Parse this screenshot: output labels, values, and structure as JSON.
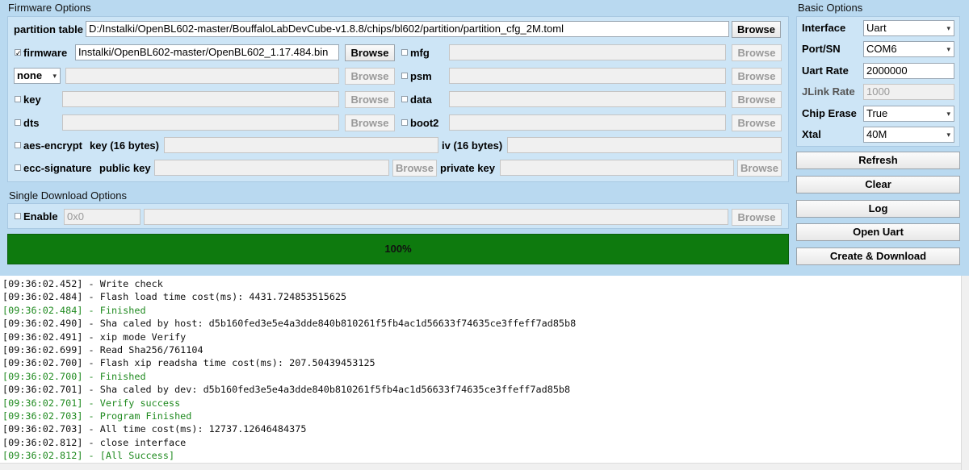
{
  "firmware_options": {
    "title": "Firmware Options",
    "partition_table_label": "partition table",
    "partition_table_value": "D:/Instalki/OpenBL602-master/BouffaloLabDevCube-v1.8.8/chips/bl602/partition/partition_cfg_2M.toml",
    "firmware_label": "firmware",
    "firmware_checked": "✓",
    "firmware_value": "Instalki/OpenBL602-master/OpenBL602_1.17.484.bin",
    "mfg_label": "mfg",
    "none_select": "none",
    "psm_label": "psm",
    "key_label": "key",
    "data_label": "data",
    "dts_label": "dts",
    "boot2_label": "boot2",
    "aes_label": "aes-encrypt",
    "aes_key_label": "key (16 bytes)",
    "iv_label": "iv (16 bytes)",
    "ecc_label": "ecc-signature",
    "public_key_label": "public key",
    "private_key_label": "private key",
    "browse_label": "Browse"
  },
  "single_download": {
    "title": "Single Download Options",
    "enable_label": "Enable",
    "address_placeholder": "0x0",
    "browse_label": "Browse"
  },
  "progress": {
    "text": "100%",
    "value": 1.0
  },
  "basic_options": {
    "title": "Basic Options",
    "interface_label": "Interface",
    "interface_value": "Uart",
    "port_label": "Port/SN",
    "port_value": "COM6",
    "uart_rate_label": "Uart Rate",
    "uart_rate_value": "2000000",
    "jlink_rate_label": "JLink Rate",
    "jlink_rate_value": "1000",
    "chip_erase_label": "Chip Erase",
    "chip_erase_value": "True",
    "xtal_label": "Xtal",
    "xtal_value": "40M"
  },
  "actions": {
    "refresh": "Refresh",
    "clear": "Clear",
    "log": "Log",
    "open_uart": "Open Uart",
    "create_download": "Create & Download"
  },
  "log_lines": [
    {
      "text": "[09:36:02.452] - Write check",
      "status": "normal"
    },
    {
      "text": "[09:36:02.484] - Flash load time cost(ms): 4431.724853515625",
      "status": "normal"
    },
    {
      "text": "[09:36:02.484] - Finished",
      "status": "success"
    },
    {
      "text": "[09:36:02.490] - Sha caled by host: d5b160fed3e5e4a3dde840b810261f5fb4ac1d56633f74635ce3ffeff7ad85b8",
      "status": "normal"
    },
    {
      "text": "[09:36:02.491] - xip mode Verify",
      "status": "normal"
    },
    {
      "text": "[09:36:02.699] - Read Sha256/761104",
      "status": "normal"
    },
    {
      "text": "[09:36:02.700] - Flash xip readsha time cost(ms): 207.50439453125",
      "status": "normal"
    },
    {
      "text": "[09:36:02.700] - Finished",
      "status": "success"
    },
    {
      "text": "[09:36:02.701] - Sha caled by dev: d5b160fed3e5e4a3dde840b810261f5fb4ac1d56633f74635ce3ffeff7ad85b8",
      "status": "normal"
    },
    {
      "text": "[09:36:02.701] - Verify success",
      "status": "success"
    },
    {
      "text": "[09:36:02.703] - Program Finished",
      "status": "success"
    },
    {
      "text": "[09:36:02.703] - All time cost(ms): 12737.12646484375",
      "status": "normal"
    },
    {
      "text": "[09:36:02.812] - close interface",
      "status": "normal"
    },
    {
      "text": "[09:36:02.812] - [All Success]",
      "status": "success"
    }
  ]
}
